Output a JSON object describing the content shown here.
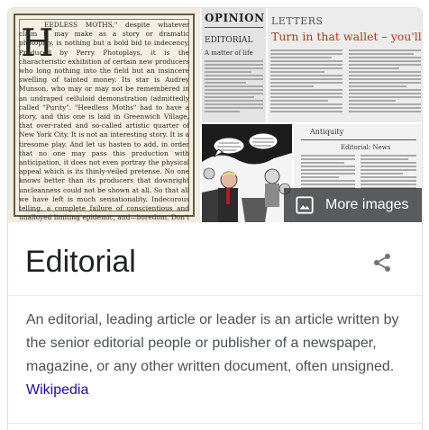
{
  "gallery": {
    "main_image": {
      "dropcap": "H",
      "text": "EEDLESS MOTHS,\" despite whatever claim it may make as a story or dramatic photoplay, is nothing but a bold bid to indecency. Produced by Perry Photoplays, it is the characteristic exhibition of certain new producers who long nothing into the field but an insincere swelling of tainted money. Its star is Audrey Munson, who may or may not be remembered in an undraped celluloid demonstration (admittedly called \"Purity\". \"Heedless Moths\" had to have a story, and this one is laid in Greenwich Village, that over-rated and so-called artistic quarter of New York City. It is not an interesting story. It is a tiresome play. And let us hasten to add, in order that no one may pass this production with anticipation, it does not even portray the physical appeal which is its thinly-veiled pretense. No one knows better than its producers that downright uncleanness could not be shown at all. So that all we have left is much sensationality. Indecorous telling, a complete failure of conscientious and unalloyed limiting epidemic, and—boredom. Don't patronize it, for it is not worth your attention from any angle. If you do patronize it, you are adding fuel to the intolerant flames of censorship."
    },
    "opinion": {
      "masthead": "OPINION",
      "section": "EDITORIAL",
      "headline": "A matter of life"
    },
    "letters": {
      "masthead": "LETTERS",
      "headline": "Turn in that wallet – you'll feel better"
    },
    "antiquity": {
      "masthead": "Antiquity",
      "headline": "Editorial: News"
    },
    "more_images_label": "More images"
  },
  "entity": {
    "title": "Editorial"
  },
  "description": {
    "text": "An editorial, leading article or leader is an article written by the senior editorial people or publisher of a newspaper, magazine, or any other written document, often unsigned.",
    "source_link": "Wikipedia"
  },
  "icons": {
    "share": "share-icon",
    "more_images": "image-icon"
  },
  "colors": {
    "link": "#1a0dab",
    "text": "#4d5156",
    "title": "#202124",
    "overlay": "#202124",
    "share": "#70757a"
  }
}
